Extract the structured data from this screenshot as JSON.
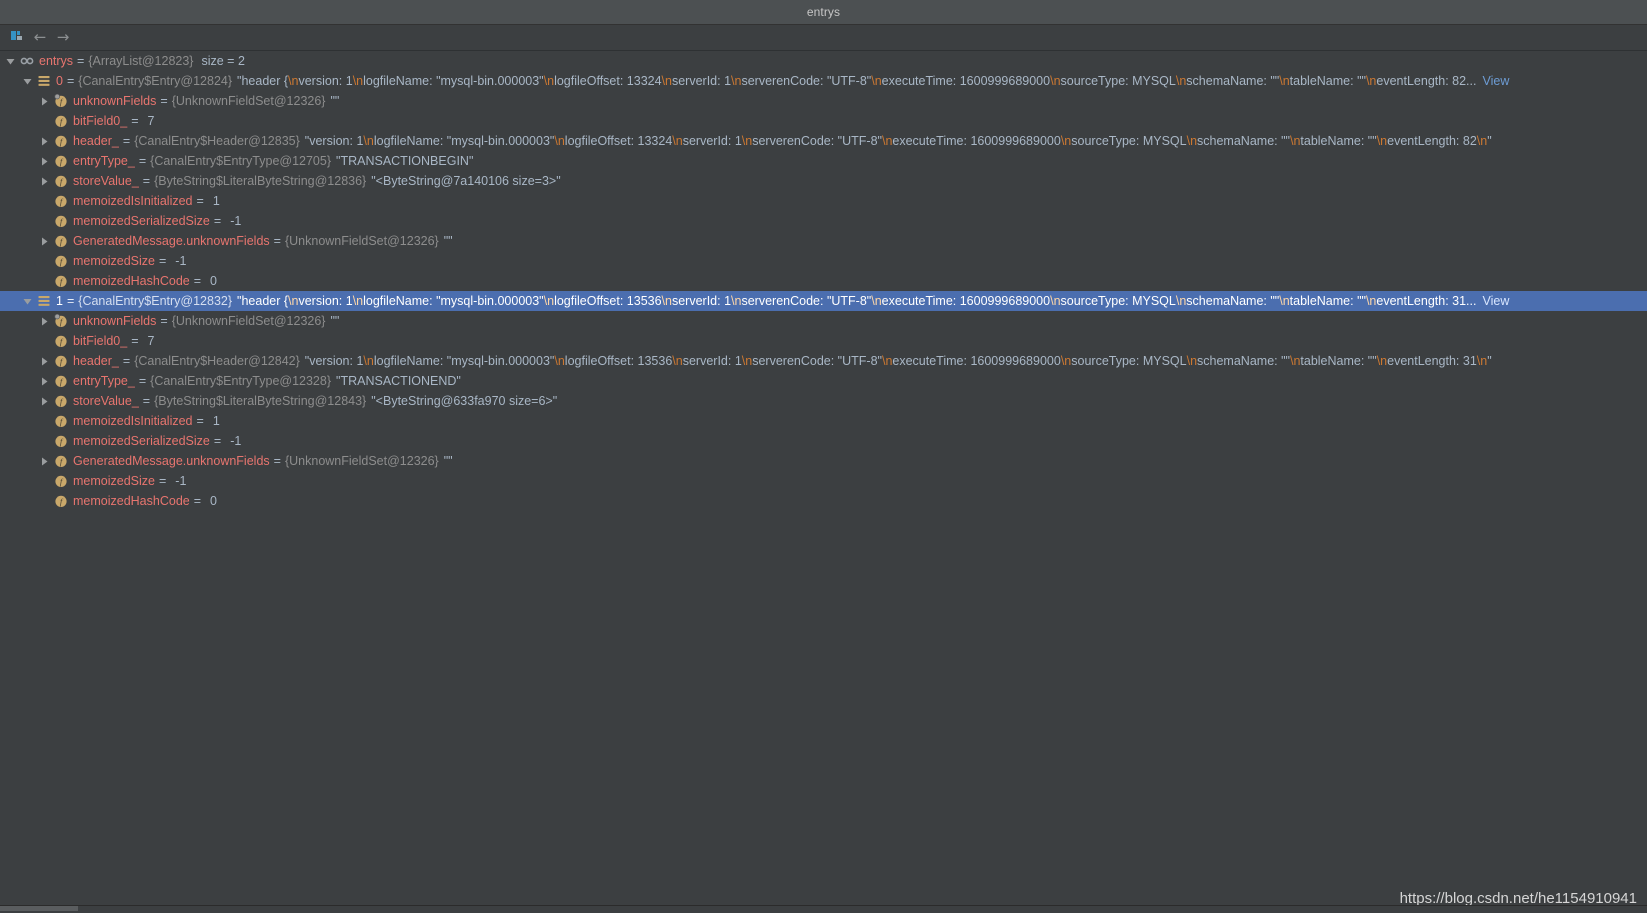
{
  "window": {
    "title": "entrys"
  },
  "toolbar": {
    "items": [
      {
        "name": "show-in-view-icon",
        "label": ""
      },
      {
        "name": "back-arrow-icon",
        "label": "←"
      },
      {
        "name": "forward-arrow-icon",
        "label": "→"
      }
    ],
    "back_glyph": "←",
    "forward_glyph": "→"
  },
  "colors": {
    "background": "#3c3f41",
    "titlebar": "#4c5052",
    "selection": "#4b6eaf",
    "field_name": "#e8756f",
    "type_hint": "#8d8d8d",
    "value": "#a9b7c6",
    "escape": "#cc7832",
    "link": "#6d9cd4",
    "icon_orange": "#c9a86a"
  },
  "tree": {
    "rows": [
      {
        "id": "row-entrys",
        "indent": 0,
        "twisty": "expanded",
        "icon": "collection-icon",
        "name": "entrys",
        "eq": "=",
        "type": "{ArrayList@12823}",
        "size_label": "size = 2",
        "value": "",
        "view_link": ""
      },
      {
        "id": "row-entry-0",
        "indent": 1,
        "twisty": "expanded",
        "icon": "array-element-icon",
        "name": "0",
        "eq": "=",
        "type": "{CanalEntry$Entry@12824}",
        "value": "\"header {\\n  version: 1\\n  logfileName: \"mysql-bin.000003\"\\n  logfileOffset: 13324\\n  serverId: 1\\n  serverenCode: \"UTF-8\"\\n  executeTime: 1600999689000\\n  sourceType: MYSQL\\n  schemaName: \"\"\\n  tableName: \"\"\\n  eventLength: 82...",
        "view_link": "View"
      },
      {
        "id": "row-0-unknownFields",
        "indent": 2,
        "twisty": "collapsed",
        "icon": "field-private-icon",
        "name": "unknownFields",
        "eq": "=",
        "type": "{UnknownFieldSet@12326}",
        "value": "\"\""
      },
      {
        "id": "row-0-bitField0",
        "indent": 2,
        "twisty": "none",
        "icon": "field-icon",
        "name": "bitField0_",
        "eq": "=",
        "type": "",
        "value": "7"
      },
      {
        "id": "row-0-header",
        "indent": 2,
        "twisty": "collapsed",
        "icon": "field-icon",
        "name": "header_",
        "eq": "=",
        "type": "{CanalEntry$Header@12835}",
        "value": "\"version: 1\\nlogfileName: \"mysql-bin.000003\"\\nlogfileOffset: 13324\\nserverId: 1\\nserverenCode: \"UTF-8\"\\nexecuteTime: 1600999689000\\nsourceType: MYSQL\\nschemaName: \"\"\\ntableName: \"\"\\neventLength: 82\\n\""
      },
      {
        "id": "row-0-entryType",
        "indent": 2,
        "twisty": "collapsed",
        "icon": "field-icon",
        "name": "entryType_",
        "eq": "=",
        "type": "{CanalEntry$EntryType@12705}",
        "value": "\"TRANSACTIONBEGIN\""
      },
      {
        "id": "row-0-storeValue",
        "indent": 2,
        "twisty": "collapsed",
        "icon": "field-icon",
        "name": "storeValue_",
        "eq": "=",
        "type": "{ByteString$LiteralByteString@12836}",
        "value": "\"<ByteString@7a140106 size=3>\""
      },
      {
        "id": "row-0-memoizedIsInitialized",
        "indent": 2,
        "twisty": "none",
        "icon": "field-icon",
        "name": "memoizedIsInitialized",
        "eq": "=",
        "type": "",
        "value": "1"
      },
      {
        "id": "row-0-memoizedSerializedSize",
        "indent": 2,
        "twisty": "none",
        "icon": "field-icon",
        "name": "memoizedSerializedSize",
        "eq": "=",
        "type": "",
        "value": "-1"
      },
      {
        "id": "row-0-generatedMessageUnknownFields",
        "indent": 2,
        "twisty": "collapsed",
        "icon": "field-icon",
        "name": "GeneratedMessage.unknownFields",
        "eq": "=",
        "type": "{UnknownFieldSet@12326}",
        "value": "\"\""
      },
      {
        "id": "row-0-memoizedSize",
        "indent": 2,
        "twisty": "none",
        "icon": "field-icon",
        "name": "memoizedSize",
        "eq": "=",
        "type": "",
        "value": "-1"
      },
      {
        "id": "row-0-memoizedHashCode",
        "indent": 2,
        "twisty": "none",
        "icon": "field-icon",
        "name": "memoizedHashCode",
        "eq": "=",
        "type": "",
        "value": "0"
      },
      {
        "id": "row-entry-1",
        "indent": 1,
        "twisty": "expanded",
        "icon": "array-element-icon",
        "name": "1",
        "eq": "=",
        "type": "{CanalEntry$Entry@12832}",
        "selected": true,
        "value": "\"header {\\n  version: 1\\n  logfileName: \"mysql-bin.000003\"\\n  logfileOffset: 13536\\n  serverId: 1\\n  serverenCode: \"UTF-8\"\\n  executeTime: 1600999689000\\n  sourceType: MYSQL\\n  schemaName: \"\"\\n  tableName: \"\"\\n  eventLength: 31...",
        "view_link": "View"
      },
      {
        "id": "row-1-unknownFields",
        "indent": 2,
        "twisty": "collapsed",
        "icon": "field-private-icon",
        "name": "unknownFields",
        "eq": "=",
        "type": "{UnknownFieldSet@12326}",
        "value": "\"\""
      },
      {
        "id": "row-1-bitField0",
        "indent": 2,
        "twisty": "none",
        "icon": "field-icon",
        "name": "bitField0_",
        "eq": "=",
        "type": "",
        "value": "7"
      },
      {
        "id": "row-1-header",
        "indent": 2,
        "twisty": "collapsed",
        "icon": "field-icon",
        "name": "header_",
        "eq": "=",
        "type": "{CanalEntry$Header@12842}",
        "value": "\"version: 1\\nlogfileName: \"mysql-bin.000003\"\\nlogfileOffset: 13536\\nserverId: 1\\nserverenCode: \"UTF-8\"\\nexecuteTime: 1600999689000\\nsourceType: MYSQL\\nschemaName: \"\"\\ntableName: \"\"\\neventLength: 31\\n\""
      },
      {
        "id": "row-1-entryType",
        "indent": 2,
        "twisty": "collapsed",
        "icon": "field-icon",
        "name": "entryType_",
        "eq": "=",
        "type": "{CanalEntry$EntryType@12328}",
        "value": "\"TRANSACTIONEND\""
      },
      {
        "id": "row-1-storeValue",
        "indent": 2,
        "twisty": "collapsed",
        "icon": "field-icon",
        "name": "storeValue_",
        "eq": "=",
        "type": "{ByteString$LiteralByteString@12843}",
        "value": "\"<ByteString@633fa970 size=6>\""
      },
      {
        "id": "row-1-memoizedIsInitialized",
        "indent": 2,
        "twisty": "none",
        "icon": "field-icon",
        "name": "memoizedIsInitialized",
        "eq": "=",
        "type": "",
        "value": "1"
      },
      {
        "id": "row-1-memoizedSerializedSize",
        "indent": 2,
        "twisty": "none",
        "icon": "field-icon",
        "name": "memoizedSerializedSize",
        "eq": "=",
        "type": "",
        "value": "-1"
      },
      {
        "id": "row-1-generatedMessageUnknownFields",
        "indent": 2,
        "twisty": "collapsed",
        "icon": "field-icon",
        "name": "GeneratedMessage.unknownFields",
        "eq": "=",
        "type": "{UnknownFieldSet@12326}",
        "value": "\"\""
      },
      {
        "id": "row-1-memoizedSize",
        "indent": 2,
        "twisty": "none",
        "icon": "field-icon",
        "name": "memoizedSize",
        "eq": "=",
        "type": "",
        "value": "-1"
      },
      {
        "id": "row-1-memoizedHashCode",
        "indent": 2,
        "twisty": "none",
        "icon": "field-icon",
        "name": "memoizedHashCode",
        "eq": "=",
        "type": "",
        "value": "0"
      }
    ]
  },
  "watermark": {
    "text": "https://blog.csdn.net/he1154910941"
  }
}
